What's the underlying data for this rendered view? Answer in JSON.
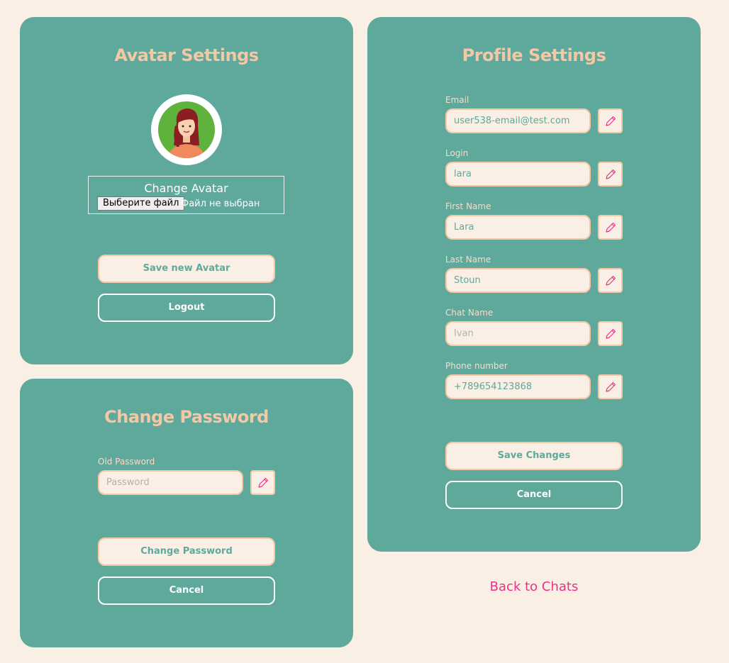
{
  "avatar_card": {
    "title": "Avatar Settings",
    "avatar_icon": "woman-avatar-icon",
    "change_avatar_label": "Change Avatar",
    "file_button_label": "Выберите файл",
    "file_status": "Файл не выбран",
    "save_button": "Save new Avatar",
    "logout_button": "Logout"
  },
  "password_card": {
    "title": "Change Password",
    "old_password_label": "Old Password",
    "old_password_placeholder": "Password",
    "change_button": "Change Password",
    "cancel_button": "Cancel"
  },
  "profile_card": {
    "title": "Profile Settings",
    "fields": [
      {
        "label": "Email",
        "value": "user538-email@test.com"
      },
      {
        "label": "Login",
        "value": "lara"
      },
      {
        "label": "First Name",
        "value": "Lara"
      },
      {
        "label": "Last Name",
        "value": "Stoun"
      },
      {
        "label": "Chat Name",
        "value": "Ivan"
      },
      {
        "label": "Phone number",
        "value": "+789654123868"
      }
    ],
    "save_button": "Save Changes",
    "cancel_button": "Cancel"
  },
  "back_link": "Back to Chats",
  "colors": {
    "background": "#f9efe4",
    "card": "#5fa99c",
    "title": "#f6c7a4",
    "link": "#e9338a",
    "edit_icon": "#e9338a"
  }
}
